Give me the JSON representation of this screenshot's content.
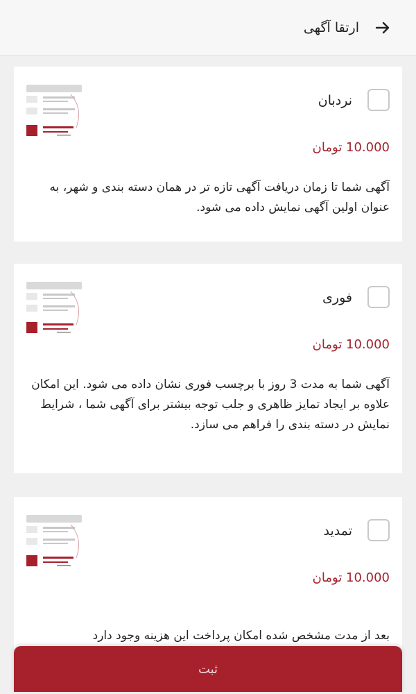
{
  "header": {
    "title": "ارتقا آگهی",
    "back_icon": "arrow-right-icon"
  },
  "options": [
    {
      "title": "نردبان",
      "price": "10.000 تومان",
      "description": "آگهی شما تا زمان دریافت آگهی تازه تر در همان دسته بندی و شهر، به عنوان اولین آگهی نمایش داده می شود."
    },
    {
      "title": "فوری",
      "price": "10.000 تومان",
      "description": "آگهی شما به مدت 3 روز با برچسب فوری نشان داده می شود. این امکان علاوه بر ایجاد تمایز ظاهری و جلب توجه بیشتر برای آگهی شما ، شرایط نمایش در دسته بندی را فراهم می سازد."
    },
    {
      "title": "تمدید",
      "price": "10.000 تومان",
      "description": "بعد از مدت مشخص شده امکان پرداخت این هزینه وجود دارد"
    }
  ],
  "submit": {
    "label": "ثبت"
  },
  "colors": {
    "accent": "#a7212c",
    "price": "#a3222d"
  }
}
